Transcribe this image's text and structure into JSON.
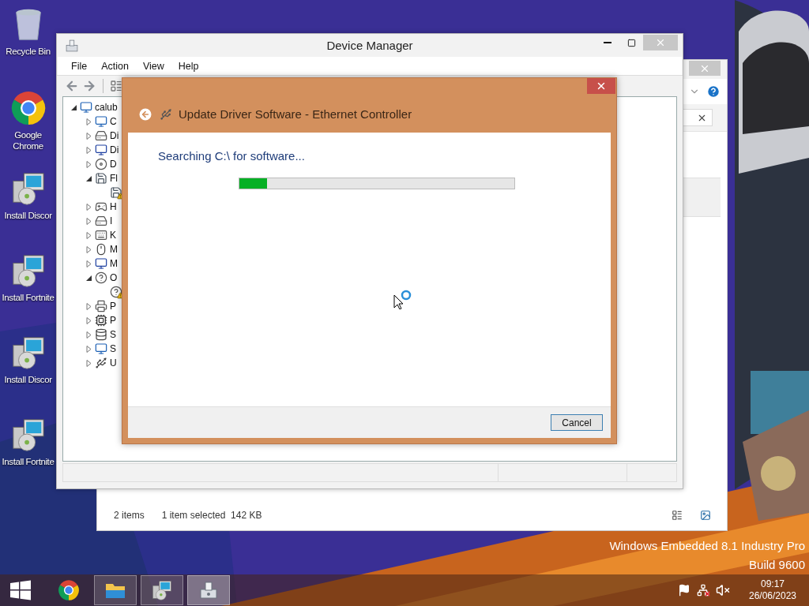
{
  "desktop": {
    "watermark": [
      "Windows Embedded 8.1 Industry Pro",
      "Build 9600"
    ]
  },
  "desktop_icons": [
    {
      "label": "Recycle Bin",
      "kind": "bin"
    },
    {
      "label": "Google Chrome",
      "kind": "browser"
    },
    {
      "label": "Install Discor",
      "kind": "installer"
    },
    {
      "label": "Install Fortnite",
      "kind": "installer"
    },
    {
      "label": "Install Discor",
      "kind": "installer"
    },
    {
      "label": "Install Fortnite",
      "kind": "installer"
    }
  ],
  "back_window": {
    "status_items": "2 items",
    "status_selected": "1 item selected  142 KB"
  },
  "device_manager": {
    "title": "Device Manager",
    "menu": [
      "File",
      "Action",
      "View",
      "Help"
    ],
    "tree": {
      "label": "calub",
      "kind": "computer",
      "expanded": true,
      "children": [
        {
          "label": "C",
          "kind": "computer",
          "expanded": false
        },
        {
          "label": "Di",
          "kind": "disk",
          "expanded": false
        },
        {
          "label": "Di",
          "kind": "display",
          "expanded": false
        },
        {
          "label": "D",
          "kind": "dvd",
          "expanded": false
        },
        {
          "label": "Fl",
          "kind": "floppy",
          "expanded": true,
          "children": [
            {
              "kind": "floppy",
              "warning": true
            }
          ]
        },
        {
          "label": "H",
          "kind": "hid",
          "expanded": false
        },
        {
          "label": "I",
          "kind": "disk",
          "expanded": false
        },
        {
          "label": "K",
          "kind": "keyboard",
          "expanded": false
        },
        {
          "label": "M",
          "kind": "mouse",
          "expanded": false
        },
        {
          "label": "M",
          "kind": "display",
          "expanded": false
        },
        {
          "label": "O",
          "kind": "other",
          "expanded": true,
          "children": [
            {
              "kind": "other",
              "warning": true
            }
          ]
        },
        {
          "label": "P",
          "kind": "printer",
          "expanded": false
        },
        {
          "label": "P",
          "kind": "processor",
          "expanded": false
        },
        {
          "label": "S",
          "kind": "storage",
          "expanded": false
        },
        {
          "label": "S",
          "kind": "computer",
          "expanded": false
        },
        {
          "label": "U",
          "kind": "usb",
          "expanded": false
        }
      ]
    }
  },
  "dialog": {
    "title": "Update Driver Software - Ethernet Controller",
    "message": "Searching C:\\ for software...",
    "progress": {
      "level": 0.1
    },
    "buttons": [
      "Cancel"
    ]
  },
  "taskbar": {
    "apps": [
      {
        "kind": "browser",
        "running": false,
        "selected": false
      },
      {
        "kind": "folder",
        "running": true,
        "selected": false
      },
      {
        "kind": "installer",
        "running": true,
        "selected": false
      },
      {
        "kind": "device-manager",
        "running": true,
        "selected": true
      }
    ],
    "network_connected": false,
    "muted": true,
    "time": "09:17",
    "date": "26/06/2023"
  }
}
